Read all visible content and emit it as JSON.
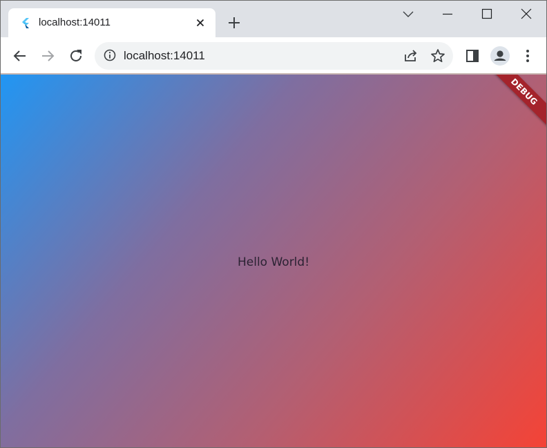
{
  "browser": {
    "tab": {
      "title": "localhost:14011",
      "favicon": "flutter-logo-icon"
    },
    "new_tab_icon": "plus-icon",
    "window_controls": [
      "tab-search-chevron-icon",
      "minimize-icon",
      "maximize-icon",
      "close-icon"
    ],
    "toolbar": {
      "back_icon": "arrow-left-icon",
      "forward_icon": "arrow-right-icon",
      "reload_icon": "reload-icon",
      "site_info_icon": "info-circle-icon",
      "url": "localhost:14011",
      "share_icon": "share-icon",
      "bookmark_icon": "star-icon",
      "side_panel_icon": "side-panel-icon",
      "profile_icon": "profile-avatar-icon",
      "menu_icon": "kebab-menu-icon"
    }
  },
  "page": {
    "message": "Hello World!",
    "debug_banner": "DEBUG",
    "gradient_start": "#2196f3",
    "gradient_end": "#f44336",
    "banner_color": "#a4232b"
  }
}
